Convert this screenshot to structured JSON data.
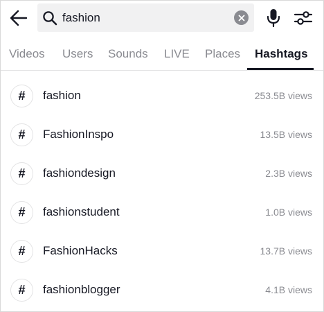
{
  "search": {
    "query": "fashion",
    "placeholder": "Search"
  },
  "icons": {
    "back": "arrow-left-icon",
    "search": "search-icon",
    "clear": "close-icon",
    "mic": "microphone-icon",
    "filter": "sliders-icon",
    "hashtag": "hashtag-icon"
  },
  "tabs": [
    {
      "label": "Videos",
      "active": false
    },
    {
      "label": "Users",
      "active": false
    },
    {
      "label": "Sounds",
      "active": false
    },
    {
      "label": "LIVE",
      "active": false
    },
    {
      "label": "Places",
      "active": false
    },
    {
      "label": "Hashtags",
      "active": true
    }
  ],
  "hashtags": [
    {
      "symbol": "#",
      "name": "fashion",
      "views": "253.5B views"
    },
    {
      "symbol": "#",
      "name": "FashionInspo",
      "views": "13.5B views"
    },
    {
      "symbol": "#",
      "name": "fashiondesign",
      "views": "2.3B views"
    },
    {
      "symbol": "#",
      "name": "fashionstudent",
      "views": "1.0B views"
    },
    {
      "symbol": "#",
      "name": "FashionHacks",
      "views": "13.7B views"
    },
    {
      "symbol": "#",
      "name": "fashionblogger",
      "views": "4.1B views"
    }
  ],
  "colors": {
    "text": "#161823",
    "secondary": "#8a8b91",
    "search_bg": "#f1f1f2",
    "divider": "#e3e3e4"
  }
}
